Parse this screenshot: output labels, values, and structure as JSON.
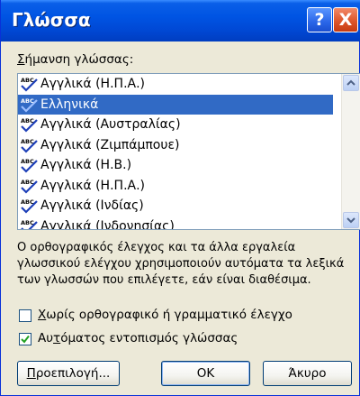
{
  "dialog": {
    "title": "Γλώσσα",
    "help_glyph": "?",
    "close_glyph": "X"
  },
  "language_label": {
    "underlined": "Σ",
    "rest": "ήμανση γλώσσας:"
  },
  "languages": [
    {
      "label": "Αγγλικά (Η.Π.Α.)",
      "selected": false,
      "spell_icon": "spell-check-icon"
    },
    {
      "label": "Ελληνικά",
      "selected": true,
      "spell_icon": "spell-check-icon"
    },
    {
      "label": "Αγγλικά (Αυστραλίας)",
      "selected": false,
      "spell_icon": "spell-check-icon"
    },
    {
      "label": "Αγγλικά (Ζιμπάμπουε)",
      "selected": false,
      "spell_icon": "spell-check-icon"
    },
    {
      "label": "Αγγλικά (Η.Β.)",
      "selected": false,
      "spell_icon": "spell-check-icon"
    },
    {
      "label": "Αγγλικά (Η.Π.Α.)",
      "selected": false,
      "spell_icon": "spell-check-icon"
    },
    {
      "label": "Αγγλικά (Ινδίας)",
      "selected": false,
      "spell_icon": "spell-check-icon"
    },
    {
      "label": "Αγγλικά (Ινδονησίας)",
      "selected": false,
      "spell_icon": "spell-check-icon"
    }
  ],
  "description": "Ο ορθογραφικός έλεγχος και τα άλλα εργαλεία γλωσσικού ελέγχου χρησιμοποιούν αυτόματα τα λεξικά των γλωσσών που επιλέγετε, εάν είναι διαθέσιμα.",
  "options": {
    "no_proofing": {
      "underlined": "Χ",
      "rest": "ωρίς ορθογραφικό ή γραμματικό έλεγχο",
      "checked": false
    },
    "auto_detect": {
      "pre": "Αυ",
      "underlined": "τ",
      "rest": "όματος εντοπισμός γλώσσας",
      "checked": true
    }
  },
  "buttons": {
    "default": {
      "underlined": "Π",
      "rest": "ροεπιλογή..."
    },
    "ok": "OK",
    "cancel": "Άκυρο"
  },
  "colors": {
    "titlebar": "#0054e3",
    "selection": "#316ac5",
    "dialog_bg": "#ece9d8",
    "close_button": "#e05a2f"
  }
}
